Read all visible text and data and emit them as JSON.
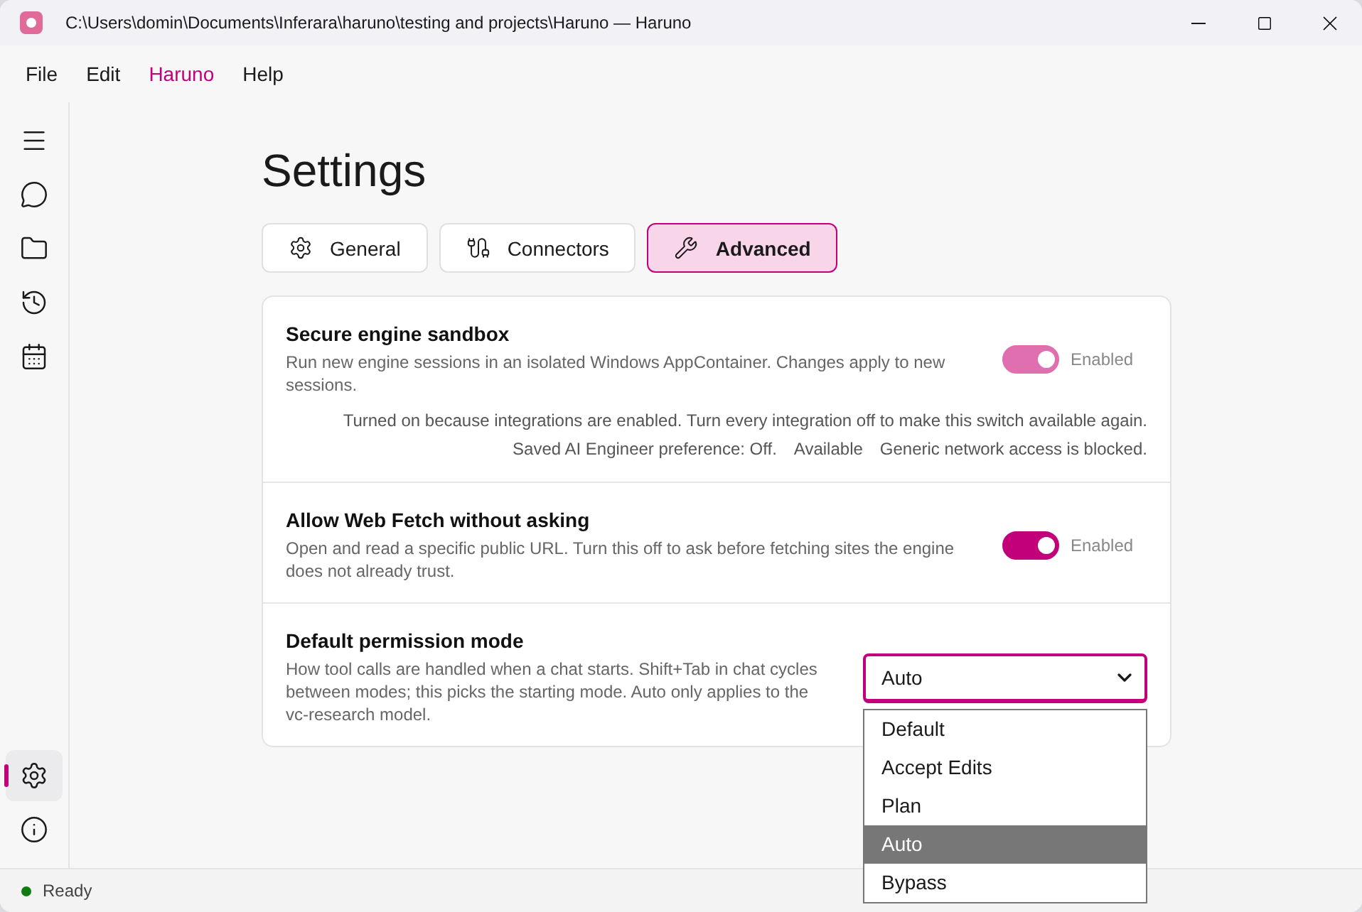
{
  "window": {
    "title": "C:\\Users\\domin\\Documents\\Inferara\\haruno\\testing and projects\\Haruno — Haruno"
  },
  "menu": [
    {
      "label": "File",
      "selected": false
    },
    {
      "label": "Edit",
      "selected": false
    },
    {
      "label": "Haruno",
      "selected": true
    },
    {
      "label": "Help",
      "selected": false
    }
  ],
  "sidebar": {
    "top": [
      {
        "kind": "menu",
        "selected": false
      },
      {
        "kind": "chat",
        "selected": false
      },
      {
        "kind": "folder",
        "selected": false
      },
      {
        "kind": "history",
        "selected": false
      },
      {
        "kind": "calendar",
        "selected": false
      }
    ],
    "bottom": [
      {
        "kind": "settings",
        "selected": true
      },
      {
        "kind": "info",
        "selected": false
      }
    ]
  },
  "page": {
    "title": "Settings"
  },
  "tabs": [
    {
      "kind": "general",
      "label": "General",
      "selected": false
    },
    {
      "kind": "connectors",
      "label": "Connectors",
      "selected": false
    },
    {
      "kind": "advanced",
      "label": "Advanced",
      "selected": true
    }
  ],
  "settings": [
    {
      "kind": "toggle",
      "title": "Secure engine sandbox",
      "description": "Run new engine sessions in an isolated Windows AppContainer. Changes apply to new sessions.",
      "on": true,
      "disabled": true,
      "state_label": "Enabled",
      "note": "Turned on because integrations are enabled. Turn every integration off to make this switch available again.",
      "status_items": [
        "Saved AI Engineer preference: Off.",
        "Available",
        "Generic network access is blocked."
      ]
    },
    {
      "kind": "toggle",
      "title": "Allow Web Fetch without asking",
      "description": "Open and read a specific public URL. Turn this off to ask before fetching sites the engine does not already trust.",
      "on": true,
      "disabled": false,
      "state_label": "Enabled"
    },
    {
      "kind": "select",
      "title": "Default permission mode",
      "description": "How tool calls are handled when a chat starts. Shift+Tab in chat cycles between modes; this picks the starting mode. Auto only applies to the vc-research model.",
      "value": "Auto",
      "expanded": true,
      "options": [
        {
          "label": "Default",
          "selected": false
        },
        {
          "label": "Accept Edits",
          "selected": false
        },
        {
          "label": "Plan",
          "selected": false
        },
        {
          "label": "Auto",
          "selected": true
        },
        {
          "label": "Bypass",
          "selected": false
        }
      ]
    }
  ],
  "status_bar": {
    "text": "Ready",
    "online": true
  }
}
